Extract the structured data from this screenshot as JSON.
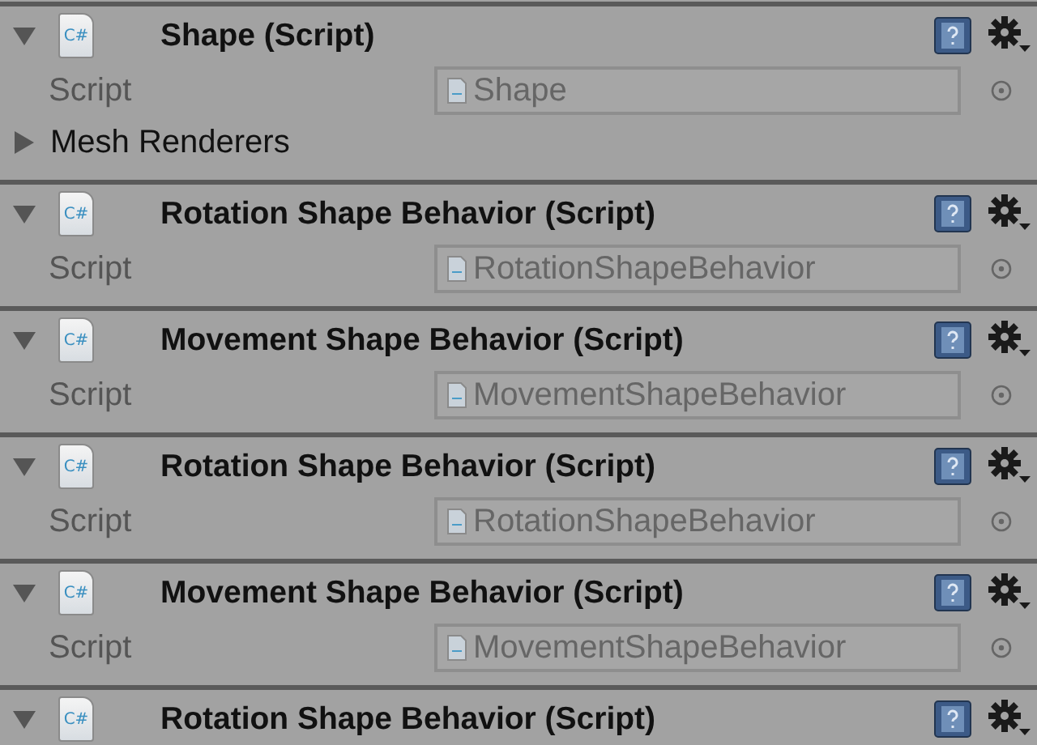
{
  "components": [
    {
      "title": "Shape (Script)",
      "icon_label": "C#",
      "expanded": true,
      "fields": [
        {
          "kind": "object",
          "label": "Script",
          "value": "Shape"
        },
        {
          "kind": "foldout",
          "label": "Mesh Renderers",
          "expanded": false
        }
      ]
    },
    {
      "title": "Rotation Shape Behavior (Script)",
      "icon_label": "C#",
      "expanded": true,
      "fields": [
        {
          "kind": "object",
          "label": "Script",
          "value": "RotationShapeBehavior"
        }
      ]
    },
    {
      "title": "Movement Shape Behavior (Script)",
      "icon_label": "C#",
      "expanded": true,
      "fields": [
        {
          "kind": "object",
          "label": "Script",
          "value": "MovementShapeBehavior"
        }
      ]
    },
    {
      "title": "Rotation Shape Behavior (Script)",
      "icon_label": "C#",
      "expanded": true,
      "fields": [
        {
          "kind": "object",
          "label": "Script",
          "value": "RotationShapeBehavior"
        }
      ]
    },
    {
      "title": "Movement Shape Behavior (Script)",
      "icon_label": "C#",
      "expanded": true,
      "fields": [
        {
          "kind": "object",
          "label": "Script",
          "value": "MovementShapeBehavior"
        }
      ]
    },
    {
      "title": "Rotation Shape Behavior (Script)",
      "icon_label": "C#",
      "expanded": true
    }
  ]
}
